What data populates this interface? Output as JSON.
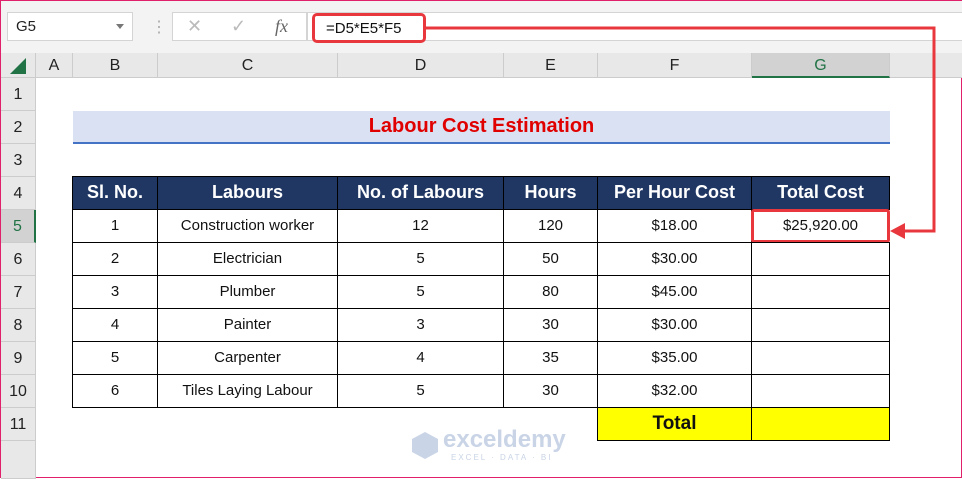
{
  "formula_bar": {
    "name_box": "G5",
    "cancel": "✕",
    "enter": "✓",
    "fx": "fx",
    "formula": "=D5*E5*F5"
  },
  "columns": [
    "A",
    "B",
    "C",
    "D",
    "E",
    "F",
    "G"
  ],
  "rows": [
    "1",
    "2",
    "3",
    "4",
    "5",
    "6",
    "7",
    "8",
    "9",
    "10",
    "11"
  ],
  "title": "Labour Cost Estimation",
  "table": {
    "headers": [
      "Sl. No.",
      "Labours",
      "No. of Labours",
      "Hours",
      "Per Hour Cost",
      "Total Cost"
    ],
    "rows": [
      [
        "1",
        "Construction worker",
        "12",
        "120",
        "$18.00",
        "$25,920.00"
      ],
      [
        "2",
        "Electrician",
        "5",
        "50",
        "$30.00",
        ""
      ],
      [
        "3",
        "Plumber",
        "5",
        "80",
        "$45.00",
        ""
      ],
      [
        "4",
        "Painter",
        "3",
        "30",
        "$30.00",
        ""
      ],
      [
        "5",
        "Carpenter",
        "4",
        "35",
        "$35.00",
        ""
      ],
      [
        "6",
        "Tiles Laying Labour",
        "5",
        "30",
        "$32.00",
        ""
      ]
    ],
    "total_label": "Total",
    "total_value": ""
  },
  "watermark": {
    "name": "exceldemy",
    "tagline": "EXCEL · DATA · BI"
  },
  "colors": {
    "header_bg": "#203764",
    "title_red": "#e00000",
    "highlight": "#ffff00",
    "annotation": "#e8383d"
  }
}
